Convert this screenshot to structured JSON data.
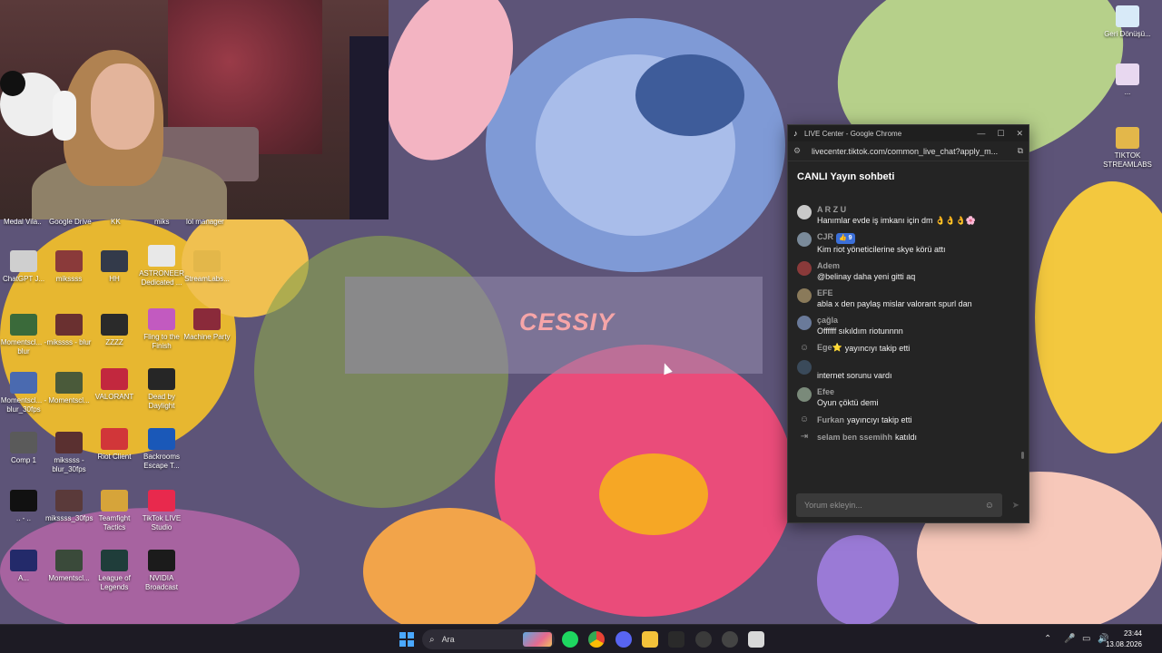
{
  "overlay": {
    "title": "CESSIY"
  },
  "desktop_top_cut_labels": [
    "Medal Vila..",
    "Google Drive",
    "KK",
    "miks",
    "lol manager"
  ],
  "desktop_icons": [
    {
      "label": "ChatGPT J...",
      "color": "#cfcfcf"
    },
    {
      "label": "mikssss",
      "color": "#8a3a3a"
    },
    {
      "label": "HH",
      "color": "#333a4a"
    },
    {
      "label": "ASTRONEER Dedicated ...",
      "color": "#e8e8e8"
    },
    {
      "label": "StreamLabs...",
      "color": "#e3b74a"
    },
    {
      "label": "Momentscl... - blur",
      "color": "#3a6a3a"
    },
    {
      "label": "mikssss - blur",
      "color": "#6a3030"
    },
    {
      "label": "ZZZZ",
      "color": "#2a2a2a"
    },
    {
      "label": "Fling to the Finish",
      "color": "#c25ac0"
    },
    {
      "label": "Machine Party",
      "color": "#8a2a3a"
    },
    {
      "label": "Momentscl... - blur_30fps",
      "color": "#4a6ab0"
    },
    {
      "label": "Momentscl...",
      "color": "#4a5a3a"
    },
    {
      "label": "VALORANT",
      "color": "#c2283e"
    },
    {
      "label": "Dead by Daylight",
      "color": "#262626"
    },
    {
      "label": "Comp 1",
      "color": "#5a5a5a"
    },
    {
      "label": "mikssss - blur_30fps",
      "color": "#5a3030"
    },
    {
      "label": "Riot Client",
      "color": "#d13639"
    },
    {
      "label": "Backrooms Escape T...",
      "color": "#1a58b8"
    },
    {
      "label": ".. - ..",
      "color": "#111111"
    },
    {
      "label": "mikssss_30fps",
      "color": "#5a3a3a"
    },
    {
      "label": "Teamfight Tactics",
      "color": "#d6a43a"
    },
    {
      "label": "TikTok LIVE Studio",
      "color": "#e8294d"
    },
    {
      "label": "A...",
      "color": "#232a6a"
    },
    {
      "label": "Momentscl...",
      "color": "#3a4a3a"
    },
    {
      "label": "League of Legends",
      "color": "#1f3d3a"
    },
    {
      "label": "NVIDIA Broadcast",
      "color": "#1b1b1b"
    }
  ],
  "right_icons": [
    {
      "label": "Geri Dönüşü...",
      "color": "#d8eaf8"
    },
    {
      "label": "...",
      "color": "#e8d8f0"
    },
    {
      "label": "TIKTOK STREAMLABS",
      "color": "#e3b74a"
    }
  ],
  "window": {
    "title": "LIVE Center - Google Chrome",
    "url": "livecenter.tiktok.com/common_live_chat?apply_m...",
    "chat_title": "CANLI Yayın sohbeti",
    "messages": [
      {
        "kind": "msg",
        "name": "A R Z U",
        "badge": "",
        "text": "Hanımlar evde iş imkanı için dm 👌👌👌🌸",
        "color": "#c9c9c9"
      },
      {
        "kind": "msg",
        "name": "CJR",
        "badge": "👍 9",
        "text": "Kim riot yöneticilerine skye körü attı",
        "color": "#7a8a9a"
      },
      {
        "kind": "msg",
        "name": "Adem",
        "badge": "",
        "text": "@belinay daha yeni gitti aq",
        "color": "#8a3a3a"
      },
      {
        "kind": "msg",
        "name": "EFE",
        "badge": "",
        "text": "abla x den paylaş mislar valorant spurl dan",
        "color": "#8a7a5a"
      },
      {
        "kind": "msg",
        "name": "çağla",
        "badge": "",
        "text": "Offffff sıkıldım riotunnnn",
        "color": "#6a7a9a"
      },
      {
        "kind": "event",
        "name": "Ege⭐",
        "text": "yayıncıyı takip etti"
      },
      {
        "kind": "msg",
        "name": "",
        "badge": "",
        "text": "internet sorunu vardı",
        "color": "#3a4a5a"
      },
      {
        "kind": "msg",
        "name": "Efee",
        "badge": "",
        "text": "Oyun çöktü demi",
        "color": "#7a8a7a"
      },
      {
        "kind": "event",
        "name": "Furkan",
        "text": "yayıncıyı takip etti"
      },
      {
        "kind": "join",
        "name": "selam ben ssemihh",
        "text": "katıldı"
      }
    ],
    "comment_placeholder": "Yorum ekleyin..."
  },
  "taskbar": {
    "search_label": "Ara",
    "time": "23:44",
    "date": "13.08.2026"
  },
  "colors": {
    "accent": "#3b6fd8",
    "chat_bg": "#242424",
    "overlay_text": "#f6a5a8"
  }
}
